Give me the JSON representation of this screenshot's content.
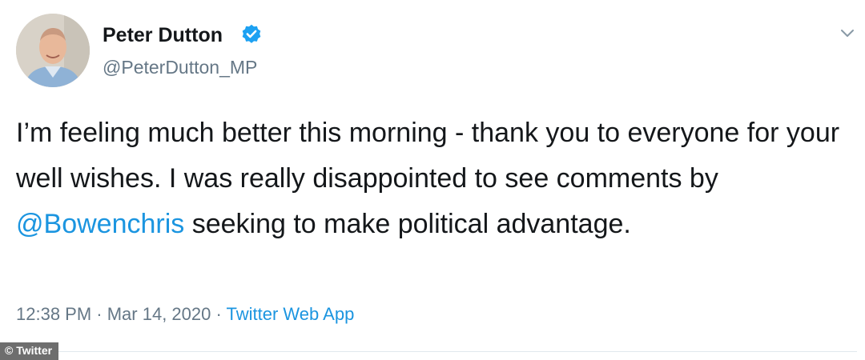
{
  "author": {
    "display_name": "Peter Dutton",
    "handle": "@PeterDutton_MP",
    "verified": true,
    "avatar_icon": "profile-photo"
  },
  "tweet": {
    "text_before": "I’m feeling much better this morning - thank you to everyone for your well wishes. I was really disappointed to see comments by ",
    "mention": "@Bowenchris",
    "text_after": " seeking to make political advantage.",
    "time": "12:38 PM",
    "date": "Mar 14, 2020",
    "source": "Twitter Web App",
    "separator": " · "
  },
  "menu": {
    "icon": "chevron-down-icon"
  },
  "watermark": {
    "text": "© Twitter"
  },
  "colors": {
    "link": "#1b95e0",
    "muted": "#657786",
    "verified_badge": "#1da1f2",
    "text": "#14171a"
  }
}
